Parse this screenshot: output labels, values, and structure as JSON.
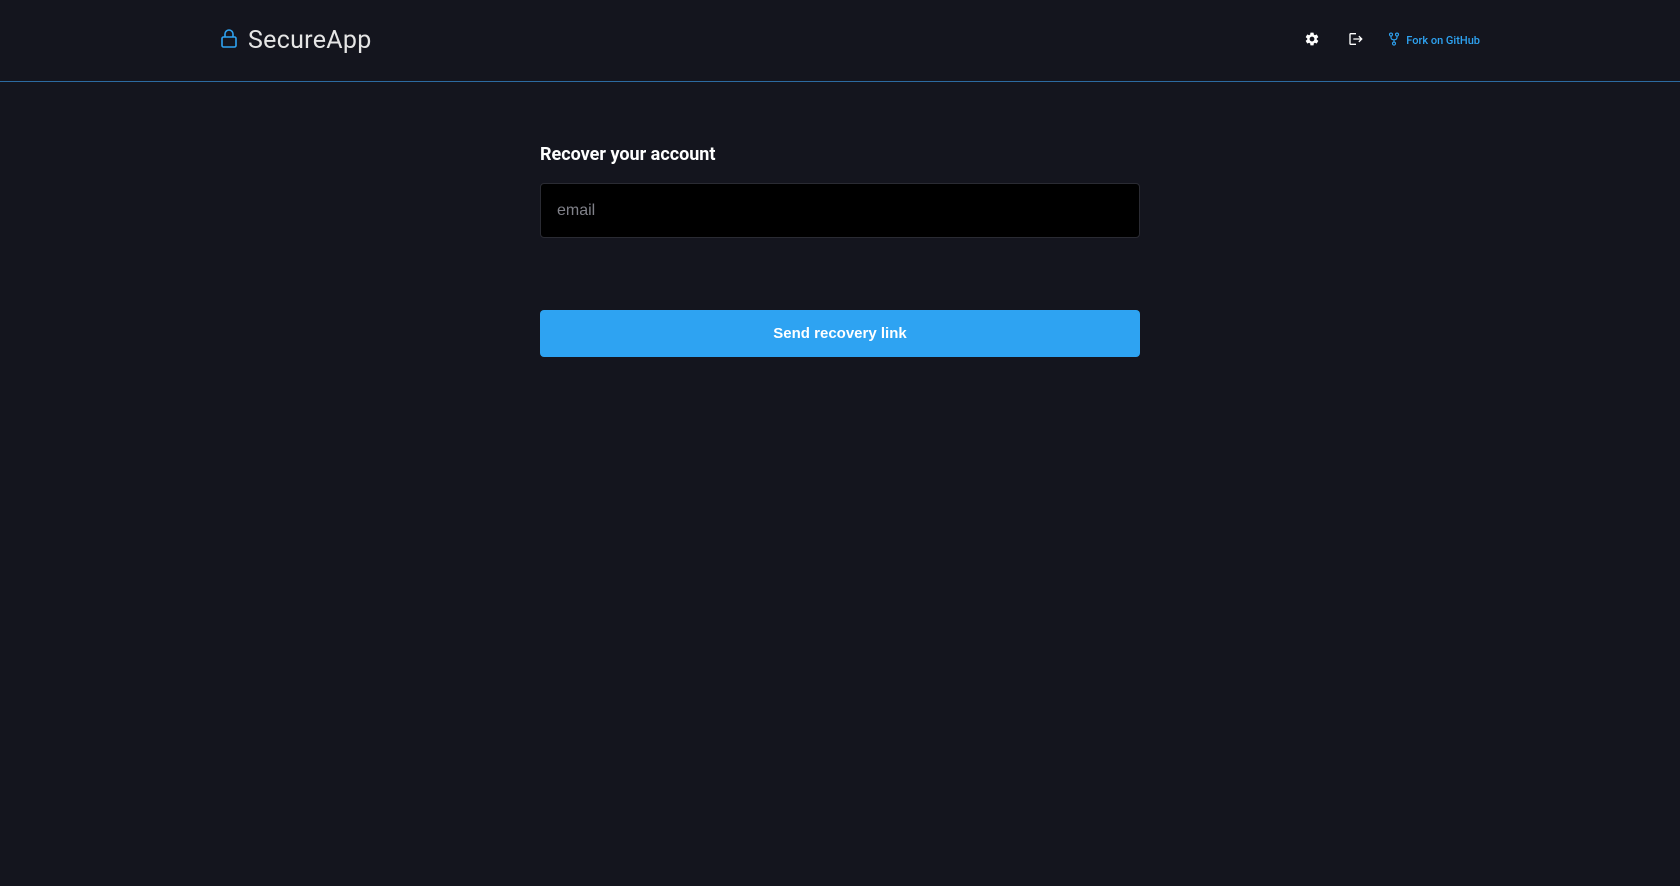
{
  "header": {
    "app_name": "SecureApp",
    "fork_label": "Fork on GitHub"
  },
  "form": {
    "title": "Recover your account",
    "email_placeholder": "email",
    "submit_label": "Send recovery link"
  },
  "colors": {
    "accent": "#2ea3f2",
    "background": "#14151e",
    "input_bg": "#000000"
  }
}
